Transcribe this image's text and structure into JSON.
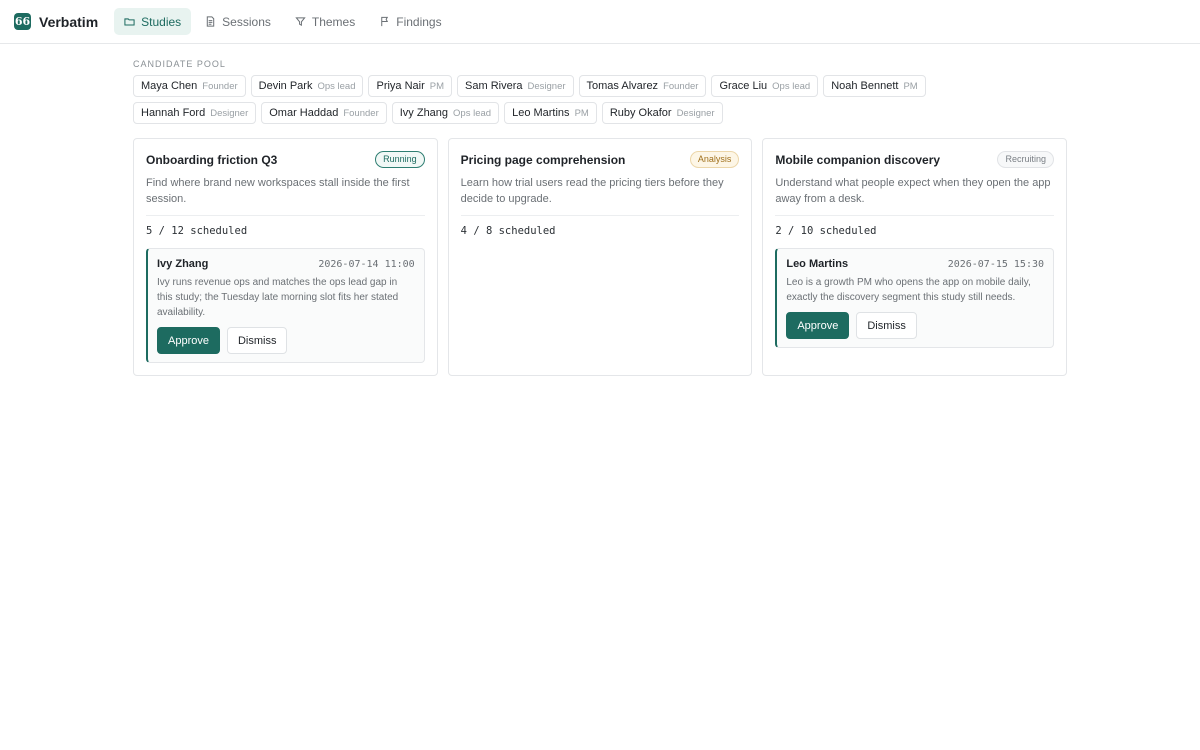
{
  "app": {
    "name": "Verbatim",
    "logo_glyph": "66",
    "accent_color": "#1d6b60"
  },
  "nav": {
    "tabs": [
      {
        "label": "Studies",
        "icon": "folder-icon",
        "active": true
      },
      {
        "label": "Sessions",
        "icon": "document-icon",
        "active": false
      },
      {
        "label": "Themes",
        "icon": "filter-icon",
        "active": false
      },
      {
        "label": "Findings",
        "icon": "flag-icon",
        "active": false
      }
    ]
  },
  "pool": {
    "label": "CANDIDATE POOL",
    "candidates": [
      {
        "name": "Maya Chen",
        "role": "Founder"
      },
      {
        "name": "Devin Park",
        "role": "Ops lead"
      },
      {
        "name": "Priya Nair",
        "role": "PM"
      },
      {
        "name": "Sam Rivera",
        "role": "Designer"
      },
      {
        "name": "Tomas Alvarez",
        "role": "Founder"
      },
      {
        "name": "Grace Liu",
        "role": "Ops lead"
      },
      {
        "name": "Noah Bennett",
        "role": "PM"
      },
      {
        "name": "Hannah Ford",
        "role": "Designer"
      },
      {
        "name": "Omar Haddad",
        "role": "Founder"
      },
      {
        "name": "Ivy Zhang",
        "role": "Ops lead"
      },
      {
        "name": "Leo Martins",
        "role": "PM"
      },
      {
        "name": "Ruby Okafor",
        "role": "Designer"
      }
    ]
  },
  "studies": [
    {
      "title": "Onboarding friction Q3",
      "status": "Running",
      "description": "Find where brand new workspaces stall inside the first session.",
      "scheduled": "5 / 12 scheduled",
      "suggestion": {
        "name": "Ivy Zhang",
        "time": "2026-07-14 11:00",
        "text": "Ivy runs revenue ops and matches the ops lead gap in this study; the Tuesday late morning slot fits her stated availability.",
        "approve_label": "Approve",
        "dismiss_label": "Dismiss"
      }
    },
    {
      "title": "Pricing page comprehension",
      "status": "Analysis",
      "description": "Learn how trial users read the pricing tiers before they decide to upgrade.",
      "scheduled": "4 / 8 scheduled"
    },
    {
      "title": "Mobile companion discovery",
      "status": "Recruiting",
      "description": "Understand what people expect when they open the app away from a desk.",
      "scheduled": "2 / 10 scheduled",
      "suggestion": {
        "name": "Leo Martins",
        "time": "2026-07-15 15:30",
        "text": "Leo is a growth PM who opens the app on mobile daily, exactly the discovery segment this study still needs.",
        "approve_label": "Approve",
        "dismiss_label": "Dismiss"
      }
    }
  ]
}
